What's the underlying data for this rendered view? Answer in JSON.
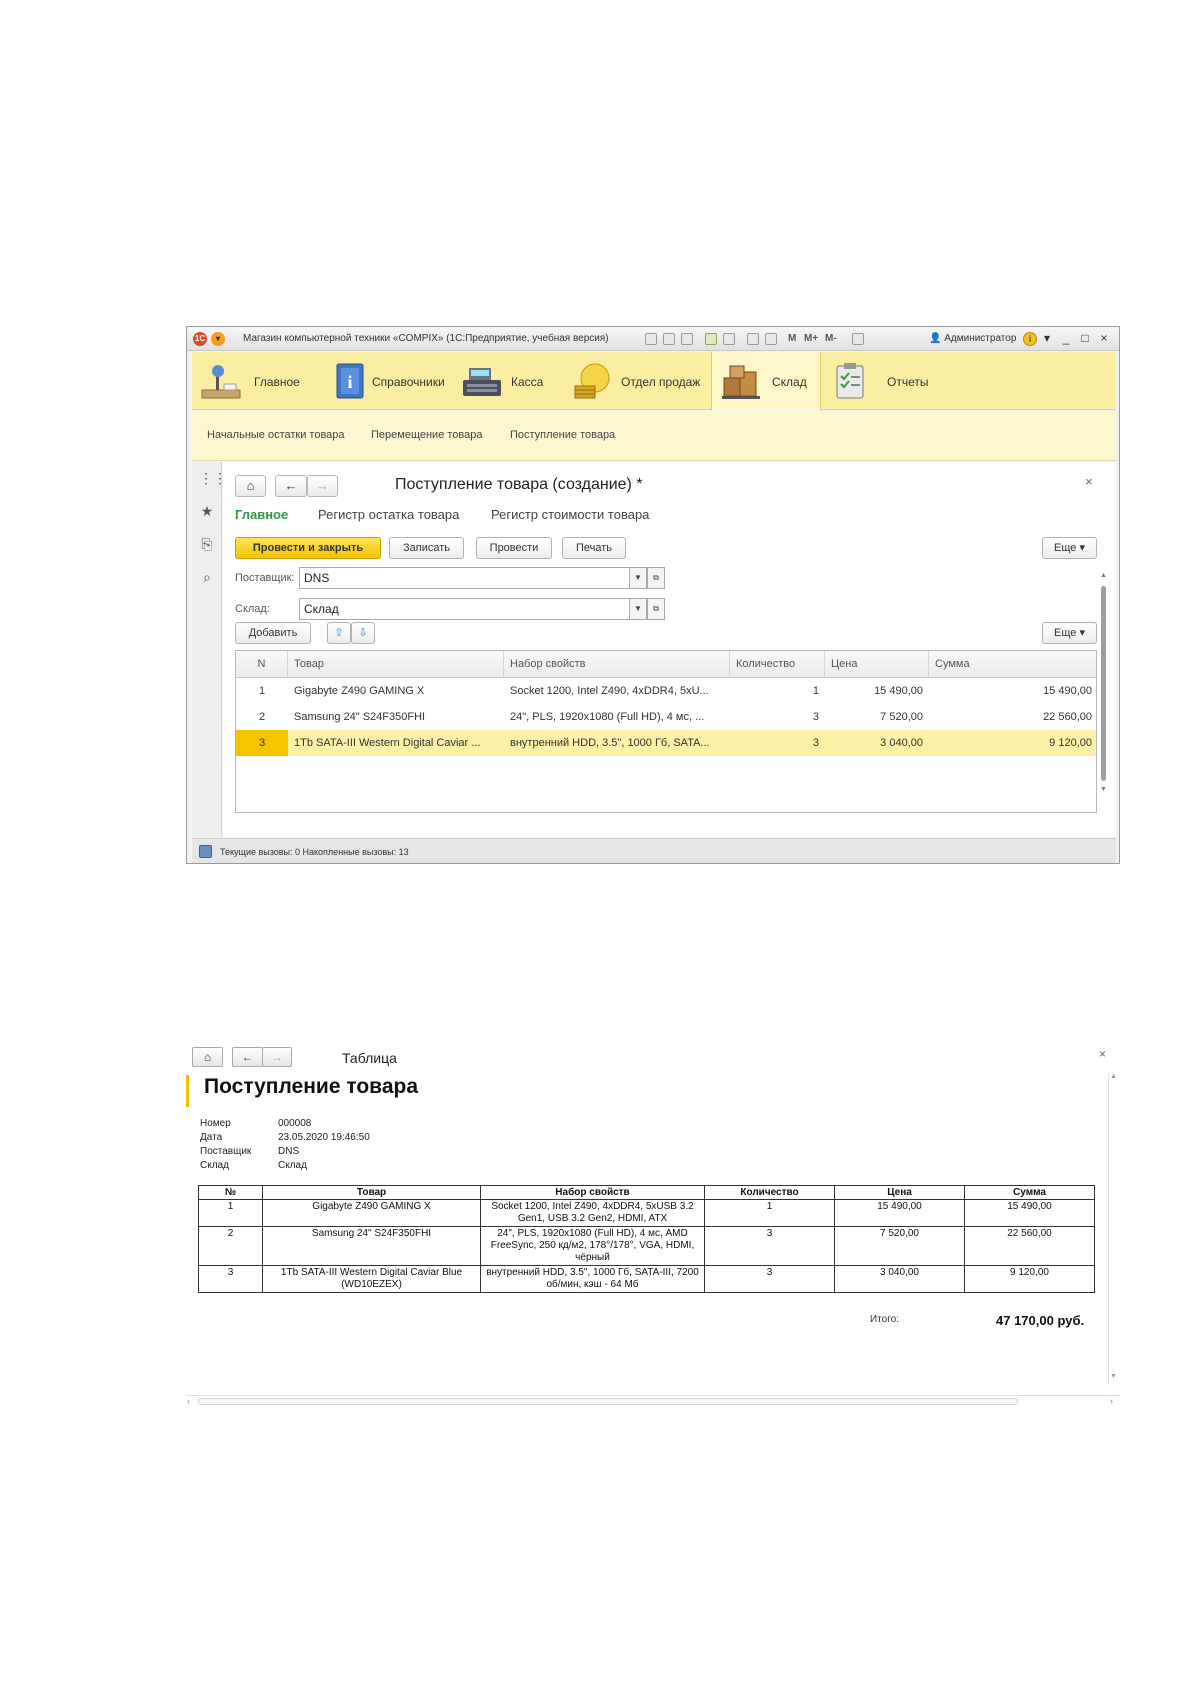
{
  "window": {
    "title": "Магазин компьютерной техники «COMPIX» (1С:Предприятие, учебная версия)",
    "m_buttons": [
      "M",
      "M+",
      "M-"
    ],
    "user": "Администратор",
    "controls": [
      "_",
      "□",
      "×"
    ]
  },
  "sections": [
    {
      "label": "Главное",
      "icon": "desk-lamp-icon",
      "active": false
    },
    {
      "label": "Справочники",
      "icon": "info-book-icon",
      "active": false
    },
    {
      "label": "Касса",
      "icon": "cash-register-icon",
      "active": false
    },
    {
      "label": "Отдел продаж",
      "icon": "coins-icon",
      "active": false
    },
    {
      "label": "Склад",
      "icon": "warehouse-boxes-icon",
      "active": true
    },
    {
      "label": "Отчеты",
      "icon": "clipboard-report-icon",
      "active": false
    }
  ],
  "subnav": [
    "Начальные остатки товара",
    "Перемещение товара",
    "Поступление товара"
  ],
  "form": {
    "title": "Поступление товара (создание) *",
    "close": "×",
    "tabs": [
      {
        "label": "Главное",
        "active": true
      },
      {
        "label": "Регистр остатка товара",
        "active": false
      },
      {
        "label": "Регистр стоимости товара",
        "active": false
      }
    ],
    "buttons": {
      "post_close": "Провести и закрыть",
      "write": "Записать",
      "post": "Провести",
      "print": "Печать",
      "more": "Еще ▾"
    },
    "supplier": {
      "label": "Поставщик:",
      "value": "DNS"
    },
    "warehouse": {
      "label": "Склад:",
      "value": "Склад"
    },
    "add_button": "Добавить",
    "more2": "Еще ▾",
    "grid": {
      "headers": [
        "N",
        "Товар",
        "Набор свойств",
        "Количество",
        "Цена",
        "Сумма"
      ],
      "rows": [
        {
          "n": "1",
          "item": "Gigabyte Z490 GAMING X",
          "props": "Socket 1200, Intel Z490, 4xDDR4, 5xU...",
          "qty": "1",
          "price": "15 490,00",
          "sum": "15 490,00",
          "selected": false
        },
        {
          "n": "2",
          "item": "Samsung 24\" S24F350FHI",
          "props": "24\", PLS, 1920x1080 (Full HD), 4 мс, ...",
          "qty": "3",
          "price": "7 520,00",
          "sum": "22 560,00",
          "selected": false
        },
        {
          "n": "3",
          "item": "1Tb SATA-III Western Digital Caviar ...",
          "props": "внутренний HDD, 3.5\", 1000 Гб, SATA...",
          "qty": "3",
          "price": "3 040,00",
          "sum": "9 120,00",
          "selected": true
        }
      ]
    }
  },
  "status": {
    "text": "Текущие вызовы: 0   Накопленные вызовы: 13"
  },
  "report": {
    "window_title": "Таблица",
    "close": "×",
    "heading": "Поступление товара",
    "fields": [
      {
        "label": "Номер",
        "value": "000008"
      },
      {
        "label": "Дата",
        "value": "23.05.2020 19:46:50"
      },
      {
        "label": "Поставщик",
        "value": "DNS"
      },
      {
        "label": "Склад",
        "value": "Склад"
      }
    ],
    "headers": [
      "№",
      "Товар",
      "Набор свойств",
      "Количество",
      "Цена",
      "Сумма"
    ],
    "rows": [
      {
        "n": "1",
        "item": "Gigabyte Z490 GAMING X",
        "props": "Socket 1200, Intel Z490, 4xDDR4, 5xUSB 3.2 Gen1, USB 3.2 Gen2, HDMI, ATX",
        "qty": "1",
        "price": "15 490,00",
        "sum": "15 490,00"
      },
      {
        "n": "2",
        "item": "Samsung 24\" S24F350FHI",
        "props": "24\", PLS, 1920x1080 (Full HD), 4 мс, AMD FreeSync, 250 кд/м2, 178°/178°, VGA, HDMI, чёрный",
        "qty": "3",
        "price": "7 520,00",
        "sum": "22 560,00"
      },
      {
        "n": "3",
        "item": "1Tb SATA-III Western Digital Caviar Blue (WD10EZEX)",
        "props": "внутренний HDD, 3.5\", 1000 Гб, SATA-III, 7200 об/мин, кэш - 64 Мб",
        "qty": "3",
        "price": "3 040,00",
        "sum": "9 120,00"
      }
    ],
    "total_label": "Итого:",
    "total_value": "47 170,00  руб."
  },
  "colors": {
    "accent_yellow": "#f2c300",
    "section_bar": "#fbeea3",
    "active_tab_green": "#2e9a45",
    "selected_row": "#fdf0a8"
  }
}
